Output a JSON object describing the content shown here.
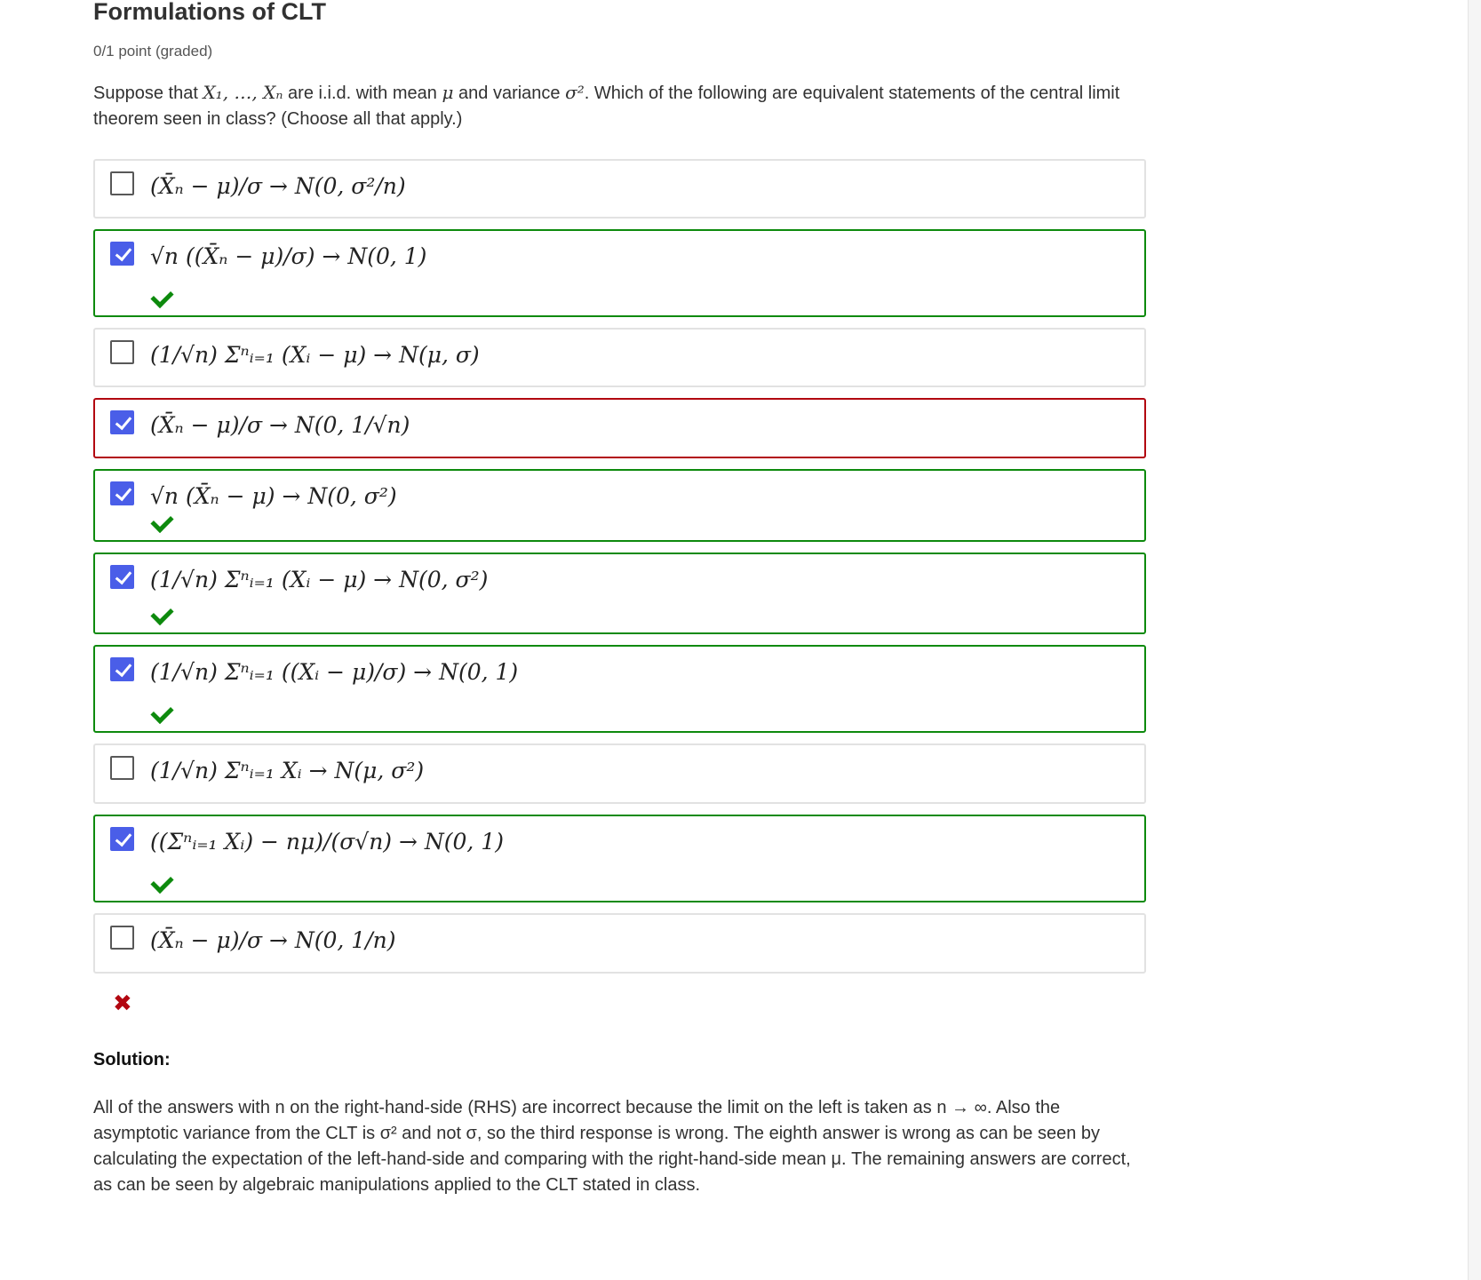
{
  "problem": {
    "title": "Formulations of CLT",
    "points": "0/1 point (graded)",
    "prompt_a": "Suppose that",
    "prompt_vars": "X₁, …, Xₙ",
    "prompt_b": "are i.i.d. with mean",
    "prompt_mu": "μ",
    "prompt_c": "and variance",
    "prompt_sigma2": "σ²",
    "prompt_d": ". Which of the following are equivalent statements of the central limit theorem seen in class? (Choose all that apply.)"
  },
  "choices": [
    {
      "formula": "(X̄ₙ − μ)/σ → N(0, σ²/n)",
      "checked": false,
      "status": "neutral"
    },
    {
      "formula": "√n ((X̄ₙ − μ)/σ) → N(0, 1)",
      "checked": true,
      "status": "correct"
    },
    {
      "formula": "(1/√n) Σⁿᵢ₌₁ (Xᵢ − μ) → N(μ, σ)",
      "checked": false,
      "status": "neutral"
    },
    {
      "formula": "(X̄ₙ − μ)/σ → N(0, 1/√n)",
      "checked": true,
      "status": "incorrect"
    },
    {
      "formula": "√n (X̄ₙ − μ) → N(0, σ²)",
      "checked": true,
      "status": "correct"
    },
    {
      "formula": "(1/√n) Σⁿᵢ₌₁ (Xᵢ − μ) → N(0, σ²)",
      "checked": true,
      "status": "correct"
    },
    {
      "formula": "(1/√n) Σⁿᵢ₌₁ ((Xᵢ − μ)/σ) → N(0, 1)",
      "checked": true,
      "status": "correct"
    },
    {
      "formula": "(1/√n) Σⁿᵢ₌₁ Xᵢ → N(μ, σ²)",
      "checked": false,
      "status": "neutral"
    },
    {
      "formula": "((Σⁿᵢ₌₁ Xᵢ) − nμ)/(σ√n) → N(0, 1)",
      "checked": true,
      "status": "correct"
    },
    {
      "formula": "(X̄ₙ − μ)/σ → N(0, 1/n)",
      "checked": false,
      "status": "neutral"
    }
  ],
  "result": {
    "wrong_icon": "✖"
  },
  "solution": {
    "label": "Solution:",
    "text": "All of the answers with n on the right-hand-side (RHS) are incorrect because the limit on the left is taken as n → ∞. Also the asymptotic variance from the CLT is σ² and not σ, so the third response is wrong. The eighth answer is wrong as can be seen by calculating the expectation of the left-hand-side and comparing with the right-hand-side mean μ. The remaining answers are correct, as can be seen by algebraic manipulations applied to the CLT stated in class."
  },
  "colors": {
    "correct": "#0d8a0d",
    "incorrect": "#b20610",
    "checkbox": "#4a5ee8"
  }
}
